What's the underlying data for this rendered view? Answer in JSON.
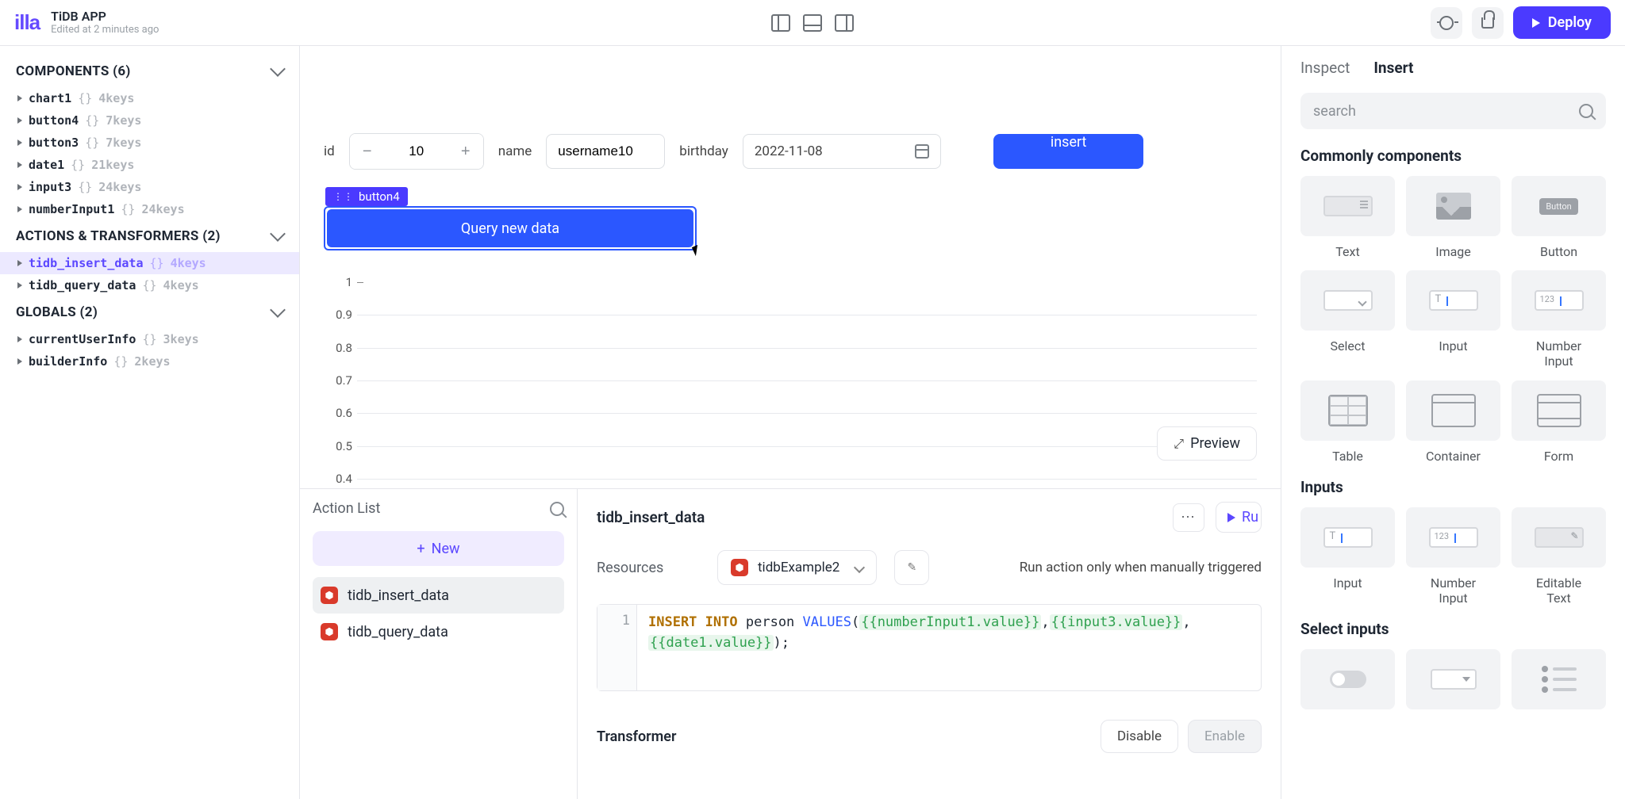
{
  "header": {
    "logo_text": "illa",
    "app_title": "TiDB APP",
    "app_subtitle": "Edited at 2 minutes ago",
    "deploy_label": "Deploy"
  },
  "left": {
    "components": {
      "title": "COMPONENTS (6)",
      "items": [
        {
          "name": "chart1",
          "meta": "4keys"
        },
        {
          "name": "button4",
          "meta": "7keys"
        },
        {
          "name": "button3",
          "meta": "7keys"
        },
        {
          "name": "date1",
          "meta": "21keys"
        },
        {
          "name": "input3",
          "meta": "24keys"
        },
        {
          "name": "numberInput1",
          "meta": "24keys"
        }
      ]
    },
    "actions": {
      "title": "ACTIONS & TRANSFORMERS (2)",
      "items": [
        {
          "name": "tidb_insert_data",
          "meta": "4keys",
          "selected": true
        },
        {
          "name": "tidb_query_data",
          "meta": "4keys",
          "selected": false
        }
      ]
    },
    "globals": {
      "title": "GLOBALS (2)",
      "items": [
        {
          "name": "currentUserInfo",
          "meta": "3keys"
        },
        {
          "name": "builderInfo",
          "meta": "2keys"
        }
      ]
    }
  },
  "canvas": {
    "id_label": "id",
    "id_value": "10",
    "name_label": "name",
    "name_value": "username10",
    "birthday_label": "birthday",
    "date_value": "2022-11-08",
    "insert_label": "insert",
    "selected_tag": "button4",
    "query_btn": "Query new data",
    "preview_label": "Preview"
  },
  "chart_data": {
    "type": "line",
    "title": "",
    "xlabel": "",
    "ylabel": "",
    "ylim": [
      0.3,
      1.0
    ],
    "yticks": [
      1,
      0.9,
      0.8,
      0.7,
      0.6,
      0.5,
      0.4
    ],
    "x": [],
    "series": []
  },
  "action_panel": {
    "list_title": "Action List",
    "new_label": "New",
    "items": [
      {
        "name": "tidb_insert_data",
        "selected": true
      },
      {
        "name": "tidb_query_data",
        "selected": false
      }
    ],
    "editor": {
      "title": "tidb_insert_data",
      "run_label": "Ru",
      "resources_label": "Resources",
      "resource_selected": "tidbExample2",
      "trigger_text": "Run action only when manually triggered",
      "code_line_no": "1",
      "code_kw1": "INSERT",
      "code_kw2": "INTO",
      "code_table": "person",
      "code_fn": "VALUES",
      "code_p_open": "(",
      "code_expr1": "{{numberInput1.value}}",
      "code_comma1": ",",
      "code_expr2": "{{input3.value}}",
      "code_comma2": ",",
      "code_expr3": "{{date1.value}}",
      "code_close": ");",
      "transformer_label": "Transformer",
      "disable_label": "Disable",
      "enable_label": "Enable"
    }
  },
  "right": {
    "tabs": {
      "inspect": "Inspect",
      "insert": "Insert"
    },
    "search_placeholder": "search",
    "sections": {
      "common": "Commonly components",
      "inputs": "Inputs",
      "select_inputs": "Select inputs"
    },
    "components": {
      "text": "Text",
      "image": "Image",
      "button": "Button",
      "select": "Select",
      "input": "Input",
      "number_input": "Number\nInput",
      "table": "Table",
      "container": "Container",
      "form": "Form",
      "input2": "Input",
      "number_input2": "Number\nInput",
      "editable_text": "Editable\nText"
    }
  }
}
